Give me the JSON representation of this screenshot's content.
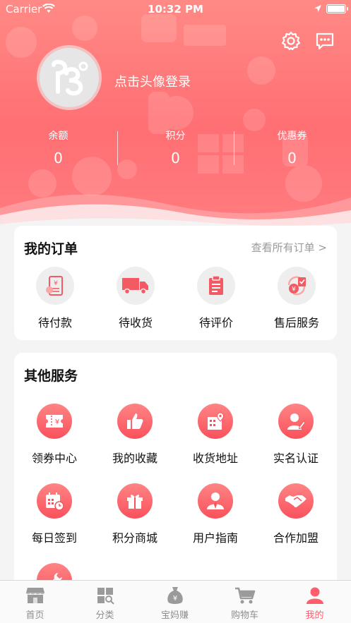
{
  "status_bar": {
    "carrier": "Carrier",
    "time": "10:32 PM"
  },
  "header": {
    "login_prompt": "点击头像登录",
    "stats": [
      {
        "label": "余额",
        "value": "0"
      },
      {
        "label": "积分",
        "value": "0"
      },
      {
        "label": "优惠券",
        "value": "0"
      }
    ]
  },
  "orders": {
    "title": "我的订单",
    "view_all": "查看所有订单 >",
    "items": [
      {
        "label": "待付款",
        "icon": "bill-icon"
      },
      {
        "label": "待收货",
        "icon": "truck-icon"
      },
      {
        "label": "待评价",
        "icon": "clipboard-icon"
      },
      {
        "label": "售后服务",
        "icon": "refund-icon"
      }
    ]
  },
  "services": {
    "title": "其他服务",
    "items": [
      {
        "label": "领券中心",
        "icon": "coupon-icon"
      },
      {
        "label": "我的收藏",
        "icon": "thumbs-up-icon"
      },
      {
        "label": "收货地址",
        "icon": "address-icon"
      },
      {
        "label": "实名认证",
        "icon": "user-verify-icon"
      },
      {
        "label": "每日签到",
        "icon": "calendar-icon"
      },
      {
        "label": "积分商城",
        "icon": "gift-icon"
      },
      {
        "label": "用户指南",
        "icon": "guide-icon"
      },
      {
        "label": "合作加盟",
        "icon": "handshake-icon"
      },
      {
        "label": "",
        "icon": "wrench-icon"
      }
    ]
  },
  "tabbar": {
    "tabs": [
      {
        "label": "首页",
        "icon": "store-icon"
      },
      {
        "label": "分类",
        "icon": "category-icon"
      },
      {
        "label": "宝妈赚",
        "icon": "money-bag-icon"
      },
      {
        "label": "购物车",
        "icon": "cart-icon"
      },
      {
        "label": "我的",
        "icon": "profile-icon"
      }
    ],
    "active_index": 4
  },
  "colors": {
    "accent": "#ff5f6d",
    "header_top": "#ff8a85",
    "header_bottom": "#ff7c80",
    "icon_gradient_start": "#ff8585",
    "icon_gradient_end": "#f9515c"
  }
}
